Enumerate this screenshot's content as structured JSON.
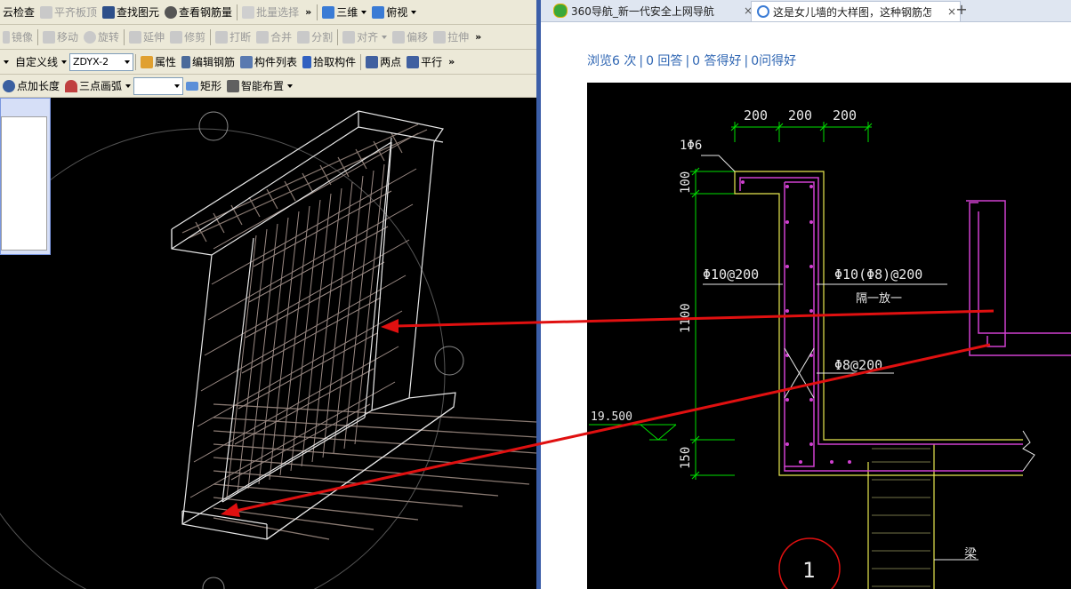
{
  "toolbar1": {
    "check": "云检查",
    "align_top": "平齐板顶",
    "find": "查找图元",
    "view_rebar": "查看钢筋量",
    "batch_select": "批量选择",
    "more": "»",
    "view3d": "三维",
    "top_view": "俯视"
  },
  "toolbar2": {
    "mirror": "镜像",
    "move": "移动",
    "rotate": "旋转",
    "extend": "延伸",
    "trim": "修剪",
    "break": "打断",
    "merge": "合并",
    "split": "分割",
    "align": "对齐",
    "offset": "偏移",
    "stretch": "拉伸",
    "more": "»"
  },
  "toolbar3": {
    "custom_line": "自定义线",
    "combo_value": "ZDYX-2",
    "properties": "属性",
    "edit_rebar": "编辑钢筋",
    "component_list": "构件列表",
    "pick": "拾取构件",
    "two_points": "两点",
    "parallel": "平行",
    "more": "»"
  },
  "toolbar4": {
    "point_length": "点加长度",
    "three_point_arc": "三点画弧",
    "combo_value": "",
    "rectangle": "矩形",
    "smart_layout": "智能布置"
  },
  "browser": {
    "tab1_title": "360导航_新一代安全上网导航",
    "tab2_title": "这是女儿墙的大样图，这种钢筋怎",
    "new_tab": "+",
    "close": "×"
  },
  "stats": {
    "views": "浏览6 次",
    "answers": "0 回答",
    "good_answers": "0 答得好",
    "questions": "0问得好",
    "separator": "|"
  },
  "cad": {
    "dim_200_a": "200",
    "dim_200_b": "200",
    "dim_200_c": "200",
    "rebar_top": "1Φ6",
    "dim_100": "100",
    "left_rebar": "Φ10@200",
    "right_rebar": "Φ10(Φ8)@200",
    "alt_note": "隔一放一",
    "dim_1100": "1100",
    "stirrup": "Φ8@200",
    "elevation": "19.500",
    "dim_150": "150",
    "beam": "梁",
    "detail_no": "1"
  },
  "colors": {
    "toolbar_bg": "#ece9d8",
    "link_blue": "#2f66b3",
    "cad_green": "#00e000",
    "cad_yellow": "#e8e850",
    "cad_magenta": "#d040d0",
    "arrow_red": "#e01010"
  }
}
